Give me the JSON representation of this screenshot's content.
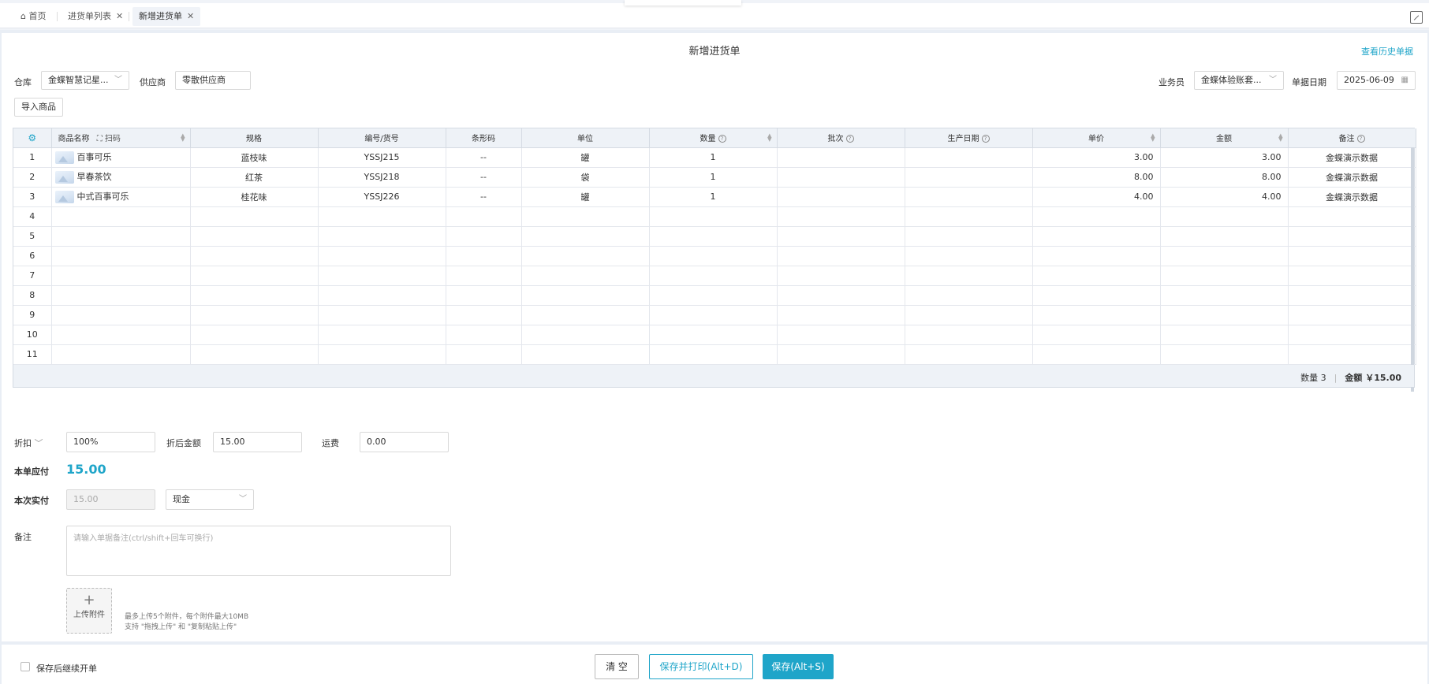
{
  "tabs": [
    {
      "label": "首页",
      "icon": "home-icon",
      "closable": false
    },
    {
      "label": "进货单列表",
      "closable": true
    },
    {
      "label": "新增进货单",
      "closable": true,
      "active": true
    }
  ],
  "page": {
    "title": "新增进货单",
    "history_link": "查看历史单据"
  },
  "form": {
    "warehouse_label": "仓库",
    "warehouse_value": "金蝶智慧记星...",
    "supplier_label": "供应商",
    "supplier_value": "零散供应商",
    "salesman_label": "业务员",
    "salesman_value": "金蝶体验账套...",
    "date_label": "单据日期",
    "date_value": "2025-06-09",
    "import_button": "导入商品"
  },
  "table": {
    "columns": [
      "商品名称",
      "扫码",
      "规格",
      "编号/货号",
      "条形码",
      "单位",
      "数量",
      "批次",
      "生产日期",
      "单价",
      "金额",
      "备注"
    ],
    "rows": [
      {
        "no": "1",
        "name": "百事可乐",
        "spec": "蓝枝味",
        "code": "YSSJ215",
        "barcode": "--",
        "unit": "罐",
        "qty": "1",
        "batch": "",
        "mfg": "",
        "price": "3.00",
        "amount": "3.00",
        "note": "金蝶演示数据"
      },
      {
        "no": "2",
        "name": "早春茶饮",
        "spec": "红茶",
        "code": "YSSJ218",
        "barcode": "--",
        "unit": "袋",
        "qty": "1",
        "batch": "",
        "mfg": "",
        "price": "8.00",
        "amount": "8.00",
        "note": "金蝶演示数据"
      },
      {
        "no": "3",
        "name": "中式百事可乐",
        "spec": "桂花味",
        "code": "YSSJ226",
        "barcode": "--",
        "unit": "罐",
        "qty": "1",
        "batch": "",
        "mfg": "",
        "price": "4.00",
        "amount": "4.00",
        "note": "金蝶演示数据"
      }
    ],
    "empty_rows": [
      "4",
      "5",
      "6",
      "7",
      "8",
      "9",
      "10",
      "11"
    ],
    "footer_qty": "数量 3",
    "footer_amount": "金额 ￥15.00"
  },
  "summary": {
    "discount_label": "折扣",
    "discount_value": "100%",
    "after_discount_label": "折后金额",
    "after_discount_value": "15.00",
    "freight_label": "运费",
    "freight_value": "0.00",
    "due_label": "本单应付",
    "due_value": "15.00",
    "paid_label": "本次实付",
    "paid_value": "15.00",
    "pay_method": "现金",
    "remark_label": "备注",
    "remark_placeholder": "请输入单据备注(ctrl/shift+回车可换行)",
    "upload_label": "上传附件",
    "upload_hint1": "最多上传5个附件，每个附件最大10MB",
    "upload_hint2": "支持 \"拖拽上传\" 和 \"复制粘贴上传\""
  },
  "bottom": {
    "continue_label": "保存后继续开单",
    "clear_button": "清 空",
    "print_button": "保存并打印(Alt+D)",
    "save_button": "保存(Alt+S)"
  },
  "colors": {
    "accent": "#1fa5c9",
    "header_bg": "#eef2f7"
  }
}
